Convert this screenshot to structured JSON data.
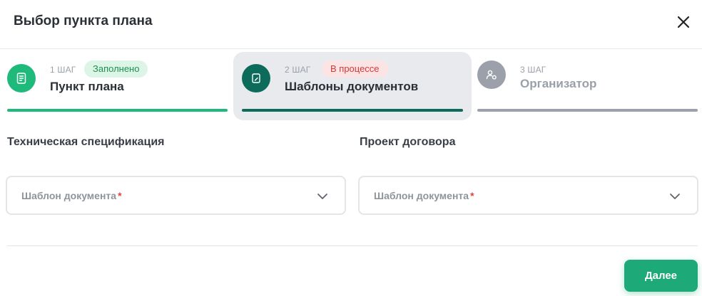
{
  "modal": {
    "title": "Выбор пункта плана",
    "close_icon": "close-icon"
  },
  "steps": [
    {
      "number": "1 ШАГ",
      "name": "Пункт плана",
      "badge": "Заполнено",
      "state": "completed",
      "icon": "document-list-icon",
      "color": "#1eb97b",
      "progress": 1
    },
    {
      "number": "2 ШАГ",
      "name": "Шаблоны документов",
      "badge": "В процессе",
      "state": "active",
      "icon": "document-edit-icon",
      "color": "#0d6b5c",
      "progress": 1
    },
    {
      "number": "3 ШАГ",
      "name": "Организатор",
      "badge": "",
      "state": "pending",
      "icon": "users-settings-icon",
      "color": "#9ca0ab",
      "progress": 1
    }
  ],
  "columns": [
    {
      "title": "Техническая спецификация",
      "select": {
        "placeholder": "Шаблон документа",
        "required_mark": "*"
      }
    },
    {
      "title": "Проект договора",
      "select": {
        "placeholder": "Шаблон документа",
        "required_mark": "*"
      }
    }
  ],
  "footer": {
    "next_label": "Далее"
  }
}
